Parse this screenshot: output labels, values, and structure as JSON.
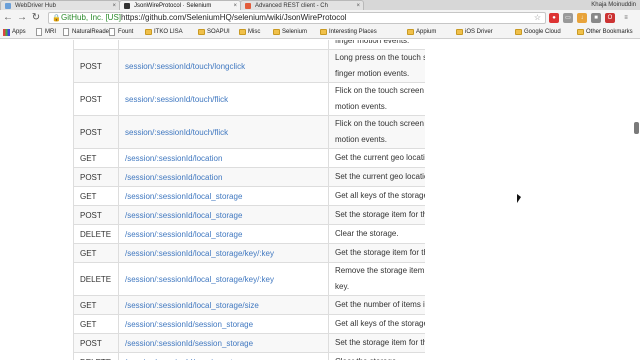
{
  "tabs": [
    {
      "title": "WebDriver Hub",
      "active": false,
      "fav_color": "#6a9fd8"
    },
    {
      "title": "JsonWireProtocol · Selenium",
      "active": true,
      "fav_color": "#333333"
    },
    {
      "title": "Advanced REST client - Ch",
      "active": false,
      "fav_color": "#e25b3a"
    }
  ],
  "profile_name": "Khaja Moinuddin",
  "omnibox": {
    "ev_label": "GitHub, Inc. [US]",
    "url": "https://github.com/SeleniumHQ/selenium/wiki/JsonWireProtocol"
  },
  "bookmarks": [
    {
      "label": "Apps",
      "kind": "apps"
    },
    {
      "label": "MRI",
      "kind": "page"
    },
    {
      "label": "NaturalReader",
      "kind": "page"
    },
    {
      "label": "Fount",
      "kind": "page"
    },
    {
      "label": "ITKO LISA",
      "kind": "folder"
    },
    {
      "label": "SOAPUI",
      "kind": "folder"
    },
    {
      "label": "Misc",
      "kind": "folder"
    },
    {
      "label": "Selenium",
      "kind": "folder"
    },
    {
      "label": "Interesting Places",
      "kind": "folder"
    },
    {
      "label": "Appium",
      "kind": "folder"
    },
    {
      "label": "iOS Driver",
      "kind": "folder"
    },
    {
      "label": "Google Cloud",
      "kind": "folder"
    },
    {
      "label": "Other Bookmarks",
      "kind": "folder"
    }
  ],
  "rows": [
    {
      "method": "",
      "command": "",
      "description": [
        "finger motion events."
      ]
    },
    {
      "method": "POST",
      "command": "session/:sessionId/touch/longclick",
      "description": [
        "Long press on the touch s",
        "finger motion events."
      ]
    },
    {
      "method": "POST",
      "command": "session/:sessionId/touch/flick",
      "description": [
        "Flick on the touch screen",
        "motion events."
      ]
    },
    {
      "method": "POST",
      "command": "session/:sessionId/touch/flick",
      "description": [
        "Flick on the touch screen",
        "motion events."
      ]
    },
    {
      "method": "GET",
      "command": "/session/:sessionId/location",
      "description": [
        "Get the current geo locatio"
      ]
    },
    {
      "method": "POST",
      "command": "/session/:sessionId/location",
      "description": [
        "Set the current geo locatio"
      ]
    },
    {
      "method": "GET",
      "command": "/session/:sessionId/local_storage",
      "description": [
        "Get all keys of the storage"
      ]
    },
    {
      "method": "POST",
      "command": "/session/:sessionId/local_storage",
      "description": [
        "Set the storage item for th"
      ]
    },
    {
      "method": "DELETE",
      "command": "/session/:sessionId/local_storage",
      "description": [
        "Clear the storage."
      ]
    },
    {
      "method": "GET",
      "command": "/session/:sessionId/local_storage/key/:key",
      "description": [
        "Get the storage item for th"
      ]
    },
    {
      "method": "DELETE",
      "command": "/session/:sessionId/local_storage/key/:key",
      "description": [
        "Remove the storage item",
        "key."
      ]
    },
    {
      "method": "GET",
      "command": "/session/:sessionId/local_storage/size",
      "description": [
        "Get the number of items in"
      ]
    },
    {
      "method": "GET",
      "command": "/session/:sessionId/session_storage",
      "description": [
        "Get all keys of the storage"
      ]
    },
    {
      "method": "POST",
      "command": "/session/:sessionId/session_storage",
      "description": [
        "Set the storage item for th"
      ]
    },
    {
      "method": "DELETE",
      "command": "/session/:sessionId/session_storage",
      "description": [
        "Clear the storage."
      ]
    }
  ]
}
